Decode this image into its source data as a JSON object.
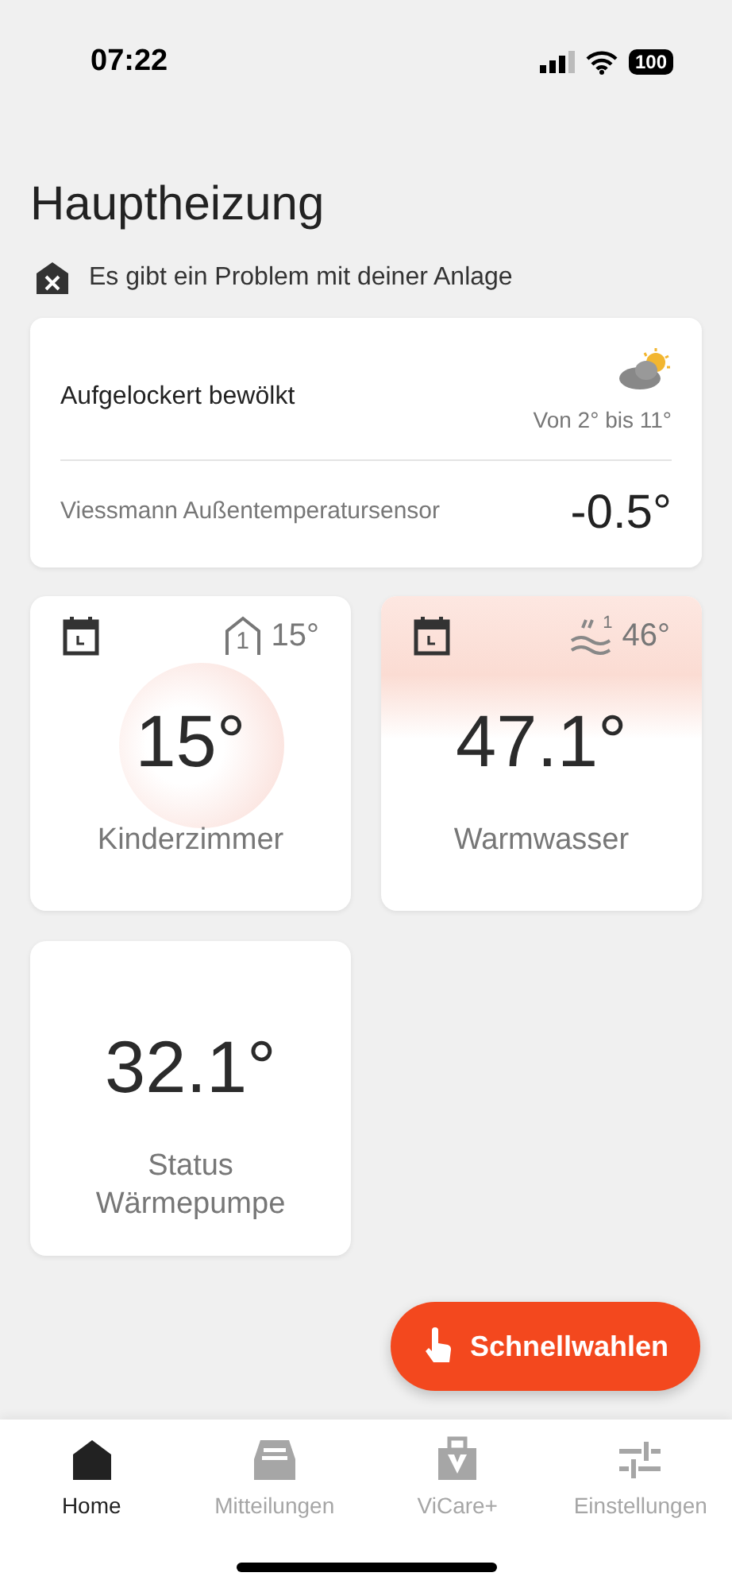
{
  "status_bar": {
    "time": "07:22",
    "battery": "100"
  },
  "title": "Hauptheizung",
  "alert": "Es gibt ein Problem mit deiner Anlage",
  "weather": {
    "condition": "Aufgelockert bewölkt",
    "range": "Von 2° bis 11°",
    "sensor": "Viessmann Außentemperatursensor",
    "temperature": "-0.5°"
  },
  "tiles": [
    {
      "kind": "room",
      "schedule": true,
      "badge": {
        "kind": "zone",
        "number": "1",
        "value": "15°"
      },
      "value": "15°",
      "label": "Kinderzimmer"
    },
    {
      "kind": "water",
      "schedule": true,
      "badge": {
        "kind": "water",
        "number": "1",
        "value": "46°"
      },
      "value": "47.1°",
      "label": "Warmwasser"
    },
    {
      "kind": "plain",
      "schedule": false,
      "value": "32.1°",
      "label": "Status Wärmepumpe"
    }
  ],
  "fab": "Schnellwahlen",
  "tab_bar": [
    {
      "kind": "home",
      "label": "Home",
      "selected": true
    },
    {
      "kind": "inbox",
      "label": "Mitteilungen",
      "selected": false
    },
    {
      "kind": "bag",
      "label": "ViCare+",
      "selected": false
    },
    {
      "kind": "sliders",
      "label": "Einstellungen",
      "selected": false
    }
  ]
}
